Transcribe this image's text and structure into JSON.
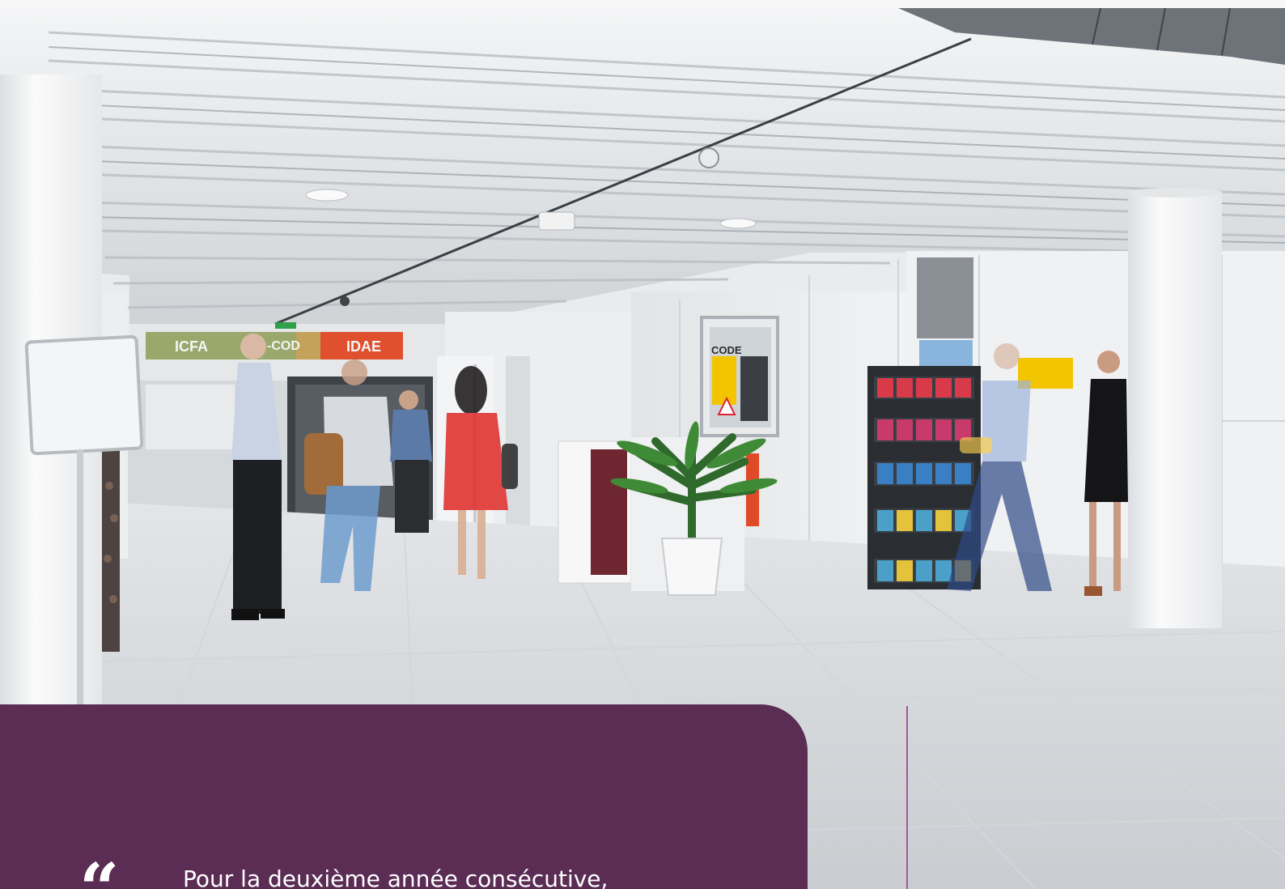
{
  "signs": {
    "left": "ICFA",
    "middle": "-COD",
    "right": "IDAE",
    "poster": "CODE"
  },
  "quote": {
    "mark": "“",
    "text": "Pour la deuxième année consécutive,"
  },
  "colors": {
    "card_purple": "#5b2d55",
    "divider_pink": "#a4579b",
    "sign_green": "#9aa86b",
    "sign_orange": "#e0502e",
    "dress_red": "#e0302e"
  }
}
